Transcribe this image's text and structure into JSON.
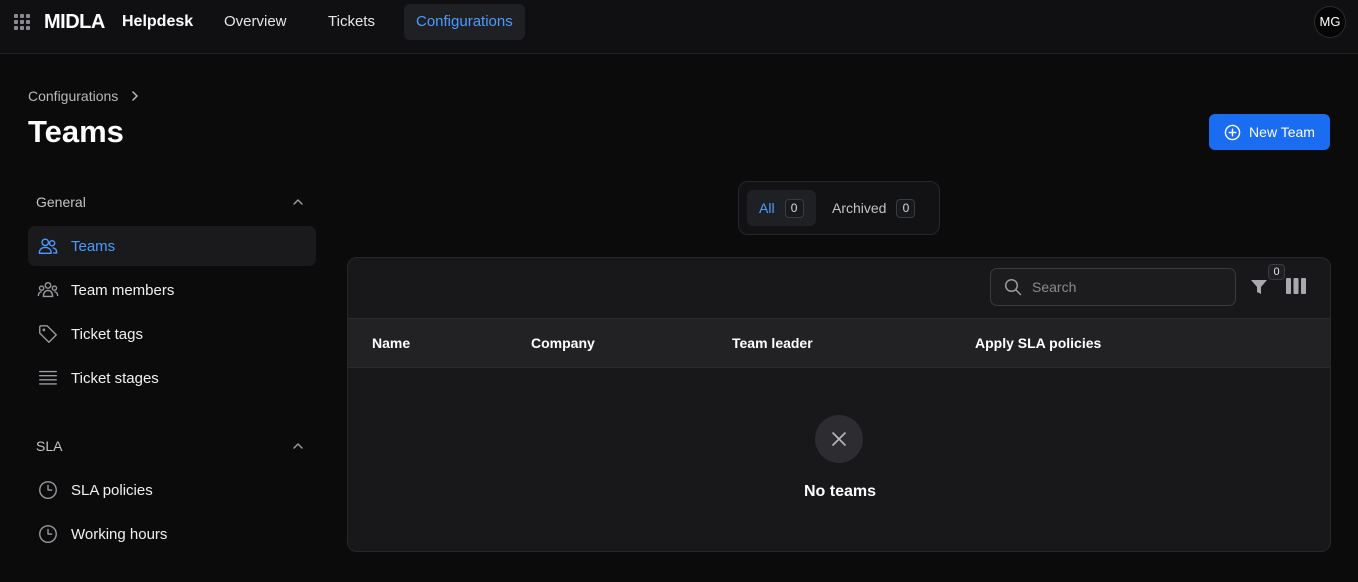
{
  "header": {
    "logo": "MIDLA",
    "app_name": "Helpdesk",
    "nav": [
      {
        "label": "Overview"
      },
      {
        "label": "Tickets"
      },
      {
        "label": "Configurations"
      }
    ],
    "avatar_initials": "MG"
  },
  "breadcrumb": {
    "parent": "Configurations"
  },
  "page_title": "Teams",
  "new_team_label": "New Team",
  "sidebar": {
    "groups": [
      {
        "title": "General",
        "items": [
          {
            "label": "Teams",
            "icon": "users-icon",
            "active": true
          },
          {
            "label": "Team members",
            "icon": "team-members-icon"
          },
          {
            "label": "Ticket tags",
            "icon": "tag-icon"
          },
          {
            "label": "Ticket stages",
            "icon": "stages-icon"
          }
        ]
      },
      {
        "title": "SLA",
        "items": [
          {
            "label": "SLA policies",
            "icon": "clock-icon"
          },
          {
            "label": "Working hours",
            "icon": "clock-icon"
          }
        ]
      }
    ]
  },
  "tabs": [
    {
      "label": "All",
      "count": "0",
      "active": true
    },
    {
      "label": "Archived",
      "count": "0"
    }
  ],
  "table": {
    "search_placeholder": "Search",
    "filter_count": "0",
    "columns": [
      "Name",
      "Company",
      "Team leader",
      "Apply SLA policies"
    ],
    "empty_text": "No teams"
  },
  "colors": {
    "accent": "#4d9bff",
    "primary_button": "#1a6cf0",
    "background": "#0b0b0c"
  }
}
